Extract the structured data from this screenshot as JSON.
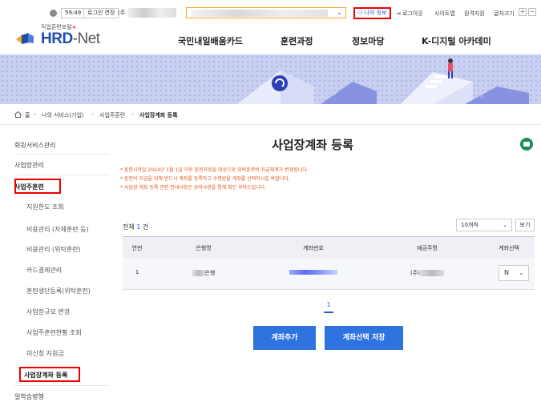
{
  "topbar": {
    "timer": "59:49",
    "extend_label": "로그인 연장",
    "company_prefix": "(주",
    "my_info": "나의 정보",
    "logout": "로그아웃",
    "sitemap": "사이트맵",
    "remote_support": "원격지원",
    "font_size": "글자크기",
    "font_plus": "+",
    "font_minus": "−"
  },
  "logo": {
    "small": "직업훈련포털",
    "main_a": "HRD",
    "main_b": "-Net"
  },
  "nav": [
    "국민내일배움카드",
    "훈련과정",
    "정보마당",
    "K-디지털 아카데미"
  ],
  "breadcrumb": [
    "홈",
    "나의 서비스(기업)",
    "사업주훈련",
    "사업장계좌 등록"
  ],
  "sidebar": {
    "items": [
      "회원서비스관리",
      "사업장관리",
      "사업주훈련"
    ],
    "sub_items": [
      "지원한도 조회",
      "비용관리 (자체훈련 등)",
      "비용관리 (위탁훈련)",
      "카드결제관리",
      "훈련생단등록(위탁훈련)",
      "사업장규모 변경",
      "사업주훈련현황 조회",
      "미신청 지원금",
      "사업장계좌 등록"
    ],
    "last_item": "일학습병행"
  },
  "main": {
    "title": "사업장계좌 등록",
    "notices": [
      "* 훈련시작일 2024년 1월 1일 이후 훈련과정을 대상으로 위탁훈련비 지급체계가 변경됩니다.",
      "* 훈련비 지급을 위해 반드시 계좌를 등록하고 수령받을 계좌를 선택하시길 바랍니다.",
      "* 사업장 계좌 등록 관련 안내사항은 공지사항을 통해 확인 부탁드립니다."
    ],
    "total_label": "전체",
    "total_count": "1",
    "total_unit": "건",
    "per_page": "10개씩",
    "view_label": "보기"
  },
  "table": {
    "headers": [
      "연번",
      "은행명",
      "계좌번호",
      "예금주명",
      "계좌선택"
    ],
    "rows": [
      {
        "no": "1",
        "bank_suffix": "은행",
        "holder_prefix": "(주)",
        "select": "N"
      }
    ]
  },
  "pagination": {
    "current": "1"
  },
  "buttons": {
    "add": "계좌추가",
    "save": "계좌선택 저장"
  }
}
